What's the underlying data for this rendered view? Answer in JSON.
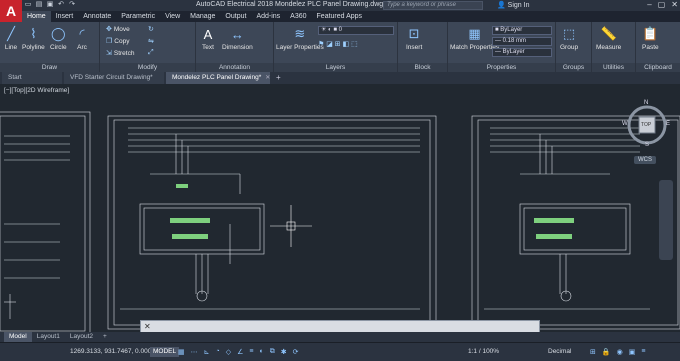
{
  "window": {
    "title": "AutoCAD Electrical 2018   Mondelez PLC Panel Drawing.dwg",
    "search_placeholder": "Type a keyword or phrase",
    "signin": "Sign In"
  },
  "ribbon_tabs": [
    "Home",
    "Insert",
    "Annotate",
    "Parametric",
    "View",
    "Manage",
    "Output",
    "Add-ins",
    "A360",
    "Featured Apps"
  ],
  "ribbon": {
    "draw": {
      "title": "Draw",
      "tools": [
        "Line",
        "Polyline",
        "Circle",
        "Arc"
      ]
    },
    "modify": {
      "title": "Modify",
      "tools": [
        "Move",
        "Copy",
        "Stretch"
      ]
    },
    "annotation": {
      "title": "Annotation",
      "tools": [
        "Text",
        "Dimension"
      ]
    },
    "layers": {
      "title": "Layers",
      "tools": [
        "Layer Properties"
      ],
      "layer_value": "0"
    },
    "block": {
      "title": "Block",
      "tools": [
        "Insert"
      ]
    },
    "properties": {
      "title": "Properties",
      "tools": [
        "Match Properties"
      ],
      "color": "ByLayer",
      "lineweight": "0.18 mm",
      "linetype": "ByLayer"
    },
    "groups": {
      "title": "Groups",
      "tools": [
        "Group"
      ]
    },
    "utilities": {
      "title": "Utilities",
      "tools": [
        "Measure"
      ]
    },
    "clipboard": {
      "title": "Clipboard",
      "tools": [
        "Paste"
      ]
    }
  },
  "doc_tabs": [
    "Start",
    "VFD Starter Circuit Drawing*",
    "Mondelez PLC Panel Drawing*"
  ],
  "viewport_label": "[−][Top][2D Wireframe]",
  "viewcube": {
    "n": "N",
    "s": "S",
    "e": "E",
    "w": "W",
    "top": "TOP",
    "wcs": "WCS"
  },
  "layout_tabs": [
    "Model",
    "Layout1",
    "Layout2"
  ],
  "status": {
    "coords": "1269.3133, 931.7467, 0.0000",
    "model": "MODEL",
    "scale": "1:1 / 100%",
    "units": "Decimal"
  },
  "colors": {
    "accent": "#8fc6ff",
    "drawing_bg": "#212830",
    "ribbon_bg": "#3d4757",
    "logo": "#c8232c"
  }
}
